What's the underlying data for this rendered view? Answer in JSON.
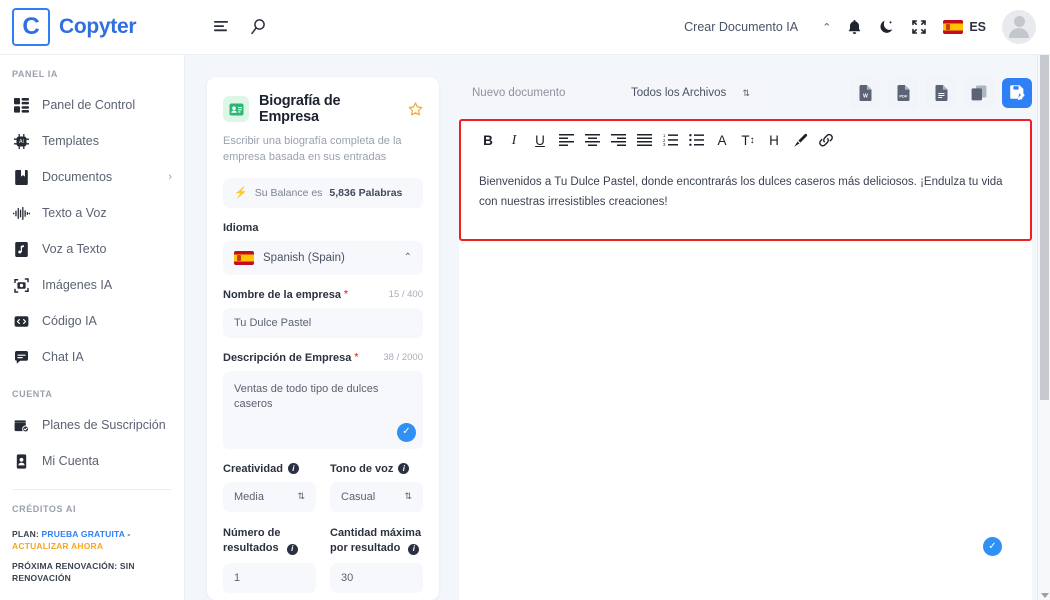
{
  "header": {
    "logo_letter": "C",
    "brand": "Copyter",
    "menu_icon": "list-menu-icon",
    "search_icon": "search-icon",
    "create_document": "Crear Documento IA",
    "chevron": "⌃",
    "notifications_icon": "bell-icon",
    "dark_mode_icon": "moon-icon",
    "fullscreen_icon": "compress-icon",
    "language_code": "ES",
    "avatar": "user-avatar"
  },
  "sidebar": {
    "section_panel": "PANEL IA",
    "items": [
      {
        "label": "Panel de Control",
        "icon": "dashboard-icon",
        "chevron": ""
      },
      {
        "label": "Templates",
        "icon": "chip-ai-icon",
        "chevron": ""
      },
      {
        "label": "Documentos",
        "icon": "documents-icon",
        "chevron": "›"
      },
      {
        "label": "Texto a Voz",
        "icon": "waveform-icon",
        "chevron": ""
      },
      {
        "label": "Voz a Texto",
        "icon": "audio-file-icon",
        "chevron": ""
      },
      {
        "label": "Imágenes IA",
        "icon": "camera-icon",
        "chevron": ""
      },
      {
        "label": "Código IA",
        "icon": "code-icon",
        "chevron": ""
      },
      {
        "label": "Chat IA",
        "icon": "chat-icon",
        "chevron": ""
      }
    ],
    "section_account": "CUENTA",
    "account_items": [
      {
        "label": "Planes de Suscripción",
        "icon": "subscription-icon"
      },
      {
        "label": "Mi Cuenta",
        "icon": "account-card-icon"
      }
    ],
    "section_credits": "CRÉDITOS AI",
    "credits": {
      "plan_prefix": "PLAN:",
      "plan_name": "PRUEBA GRATUITA",
      "dash": "-",
      "upgrade": "ACTUALIZAR AHORA",
      "renewal": "PRÓXIMA RENOVACIÓN: SIN RENOVACIÓN"
    }
  },
  "form": {
    "badge_icon": "id-card-icon",
    "title": "Biografía de Empresa",
    "star_icon": "star-icon",
    "subtitle": "Escribir una biografía completa de la empresa basada en sus entradas",
    "balance": {
      "bolt_icon": "bolt-icon",
      "text_prefix": "Su Balance es",
      "amount": "5,836 Palabras"
    },
    "language_label": "Idioma",
    "language_value": "Spanish (Spain)",
    "language_caret": "⌃",
    "company_name_label": "Nombre de la empresa",
    "company_name_counter": "15 / 400",
    "company_name_value": "Tu Dulce Pastel",
    "description_label": "Descripción de Empresa",
    "description_counter": "38 / 2000",
    "description_value": "Ventas de todo tipo de dulces caseros",
    "description_check_icon": "check-circle-icon",
    "creativity_label": "Creatividad",
    "creativity_value": "Media",
    "tone_label": "Tono de voz",
    "tone_value": "Casual",
    "results_label": "Número de resultados",
    "results_value": "1",
    "max_amount_label": "Cantidad máxima por resultado",
    "max_amount_value": "30",
    "required_mark": "*",
    "info_icon": "info-icon"
  },
  "document_bar": {
    "doc_name_placeholder": "Nuevo documento",
    "filter_value": "Todos los Archivos",
    "actions": [
      {
        "name": "export-word-button",
        "icon": "word-file-icon",
        "label": "W"
      },
      {
        "name": "export-pdf-button",
        "icon": "pdf-file-icon",
        "label": "PDF"
      },
      {
        "name": "export-text-button",
        "icon": "text-file-icon",
        "label": ""
      },
      {
        "name": "copy-button",
        "icon": "copy-icon",
        "label": ""
      },
      {
        "name": "save-document-button",
        "icon": "save-document-icon",
        "label": ""
      }
    ]
  },
  "editor": {
    "toolbar": [
      {
        "name": "bold-button",
        "glyph": "B",
        "style": "bold"
      },
      {
        "name": "italic-button",
        "glyph": "I",
        "style": "italic"
      },
      {
        "name": "underline-button",
        "glyph": "U",
        "style": "underline"
      },
      {
        "name": "align-left-button",
        "glyph": "align-left-icon",
        "style": "icon"
      },
      {
        "name": "align-center-button",
        "glyph": "align-center-icon",
        "style": "icon"
      },
      {
        "name": "align-right-button",
        "glyph": "align-right-icon",
        "style": "icon"
      },
      {
        "name": "align-justify-button",
        "glyph": "align-justify-icon",
        "style": "icon"
      },
      {
        "name": "ordered-list-button",
        "glyph": "ordered-list-icon",
        "style": "icon"
      },
      {
        "name": "unordered-list-button",
        "glyph": "unordered-list-icon",
        "style": "icon"
      },
      {
        "name": "font-color-button",
        "glyph": "A",
        "style": "plain"
      },
      {
        "name": "font-size-button",
        "glyph": "T↕",
        "style": "plain"
      },
      {
        "name": "heading-button",
        "glyph": "H",
        "style": "plain"
      },
      {
        "name": "brush-button",
        "glyph": "brush-icon",
        "style": "icon"
      },
      {
        "name": "link-button",
        "glyph": "link-icon",
        "style": "icon"
      }
    ],
    "content": "Bienvenidos a Tu Dulce Pastel, donde encontrarás los dulces caseros más deliciosos. ¡Endulza tu vida con nuestras irresistibles creaciones!",
    "canvas_check_icon": "check-circle-icon",
    "highlight_color": "#ef2020"
  },
  "colors": {
    "brand_blue": "#2f6fe0",
    "accent_blue": "#2f80f7",
    "upgrade_orange": "#f5a623",
    "required_red": "#ef4444",
    "highlight_red": "#ef2020",
    "main_background": "#f3f6fa"
  }
}
